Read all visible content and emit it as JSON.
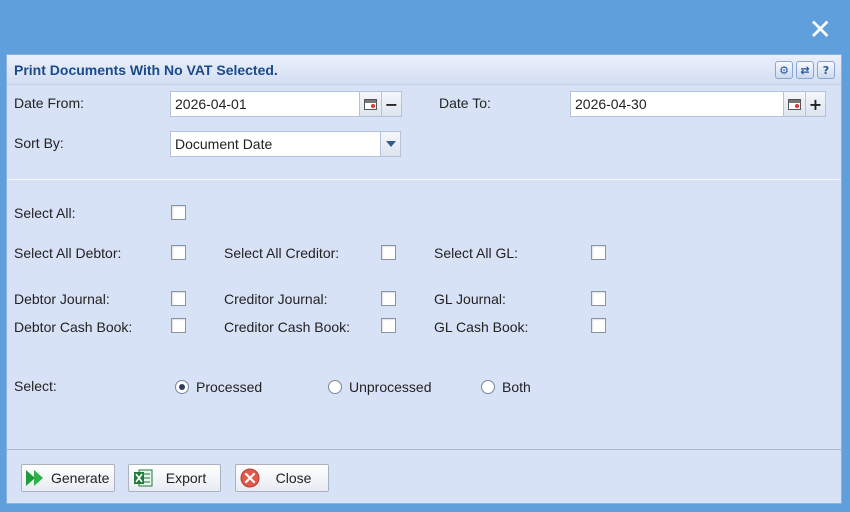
{
  "dialog": {
    "title": "Print Documents With No VAT Selected.",
    "close_glyph": "✕",
    "tools": [
      {
        "name": "settings-icon",
        "glyph": "⚙"
      },
      {
        "name": "refresh-icon",
        "glyph": "⇄"
      },
      {
        "name": "help-icon",
        "glyph": "?"
      }
    ]
  },
  "filters": {
    "date_from_label": "Date From:",
    "date_from_value": "2026-04-01",
    "date_from_step": "−",
    "date_to_label": "Date To:",
    "date_to_value": "2026-04-30",
    "date_to_step": "+",
    "sort_by_label": "Sort By:",
    "sort_by_value": "Document Date"
  },
  "selection": {
    "select_all": "Select All:",
    "select_all_debtor": "Select All Debtor:",
    "select_all_creditor": "Select All Creditor:",
    "select_all_gl": "Select All GL:",
    "debtor_journal": "Debtor Journal:",
    "creditor_journal": "Creditor Journal:",
    "gl_journal": "GL Journal:",
    "debtor_cash_book": "Debtor Cash Book:",
    "creditor_cash_book": "Creditor Cash Book:",
    "gl_cash_book": "GL Cash Book:"
  },
  "status": {
    "label": "Select:",
    "options": [
      "Processed",
      "Unprocessed",
      "Both"
    ],
    "selected": "Processed"
  },
  "buttons": {
    "generate": "Generate",
    "export": "Export",
    "close": "Close"
  },
  "colors": {
    "backdrop": "#5e9fdc",
    "panel": "#d8e2f7",
    "title_text": "#1b4a8c",
    "generate_icon": "#1e9b3a",
    "export_icon": "#1f7a3c",
    "close_icon": "#e05a4c"
  }
}
